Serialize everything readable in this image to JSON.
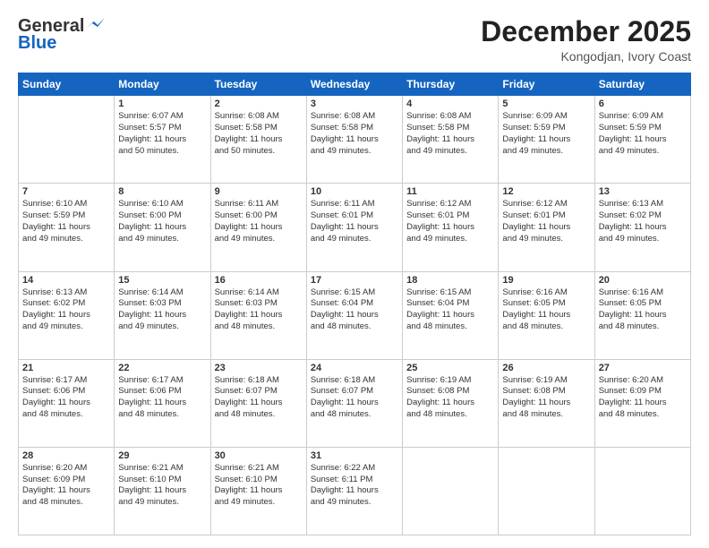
{
  "header": {
    "logo_line1": "General",
    "logo_line2": "Blue",
    "month": "December 2025",
    "location": "Kongodjan, Ivory Coast"
  },
  "weekdays": [
    "Sunday",
    "Monday",
    "Tuesday",
    "Wednesday",
    "Thursday",
    "Friday",
    "Saturday"
  ],
  "weeks": [
    [
      {
        "day": "",
        "info": ""
      },
      {
        "day": "1",
        "info": "Sunrise: 6:07 AM\nSunset: 5:57 PM\nDaylight: 11 hours\nand 50 minutes."
      },
      {
        "day": "2",
        "info": "Sunrise: 6:08 AM\nSunset: 5:58 PM\nDaylight: 11 hours\nand 50 minutes."
      },
      {
        "day": "3",
        "info": "Sunrise: 6:08 AM\nSunset: 5:58 PM\nDaylight: 11 hours\nand 49 minutes."
      },
      {
        "day": "4",
        "info": "Sunrise: 6:08 AM\nSunset: 5:58 PM\nDaylight: 11 hours\nand 49 minutes."
      },
      {
        "day": "5",
        "info": "Sunrise: 6:09 AM\nSunset: 5:59 PM\nDaylight: 11 hours\nand 49 minutes."
      },
      {
        "day": "6",
        "info": "Sunrise: 6:09 AM\nSunset: 5:59 PM\nDaylight: 11 hours\nand 49 minutes."
      }
    ],
    [
      {
        "day": "7",
        "info": "Sunrise: 6:10 AM\nSunset: 5:59 PM\nDaylight: 11 hours\nand 49 minutes."
      },
      {
        "day": "8",
        "info": "Sunrise: 6:10 AM\nSunset: 6:00 PM\nDaylight: 11 hours\nand 49 minutes."
      },
      {
        "day": "9",
        "info": "Sunrise: 6:11 AM\nSunset: 6:00 PM\nDaylight: 11 hours\nand 49 minutes."
      },
      {
        "day": "10",
        "info": "Sunrise: 6:11 AM\nSunset: 6:01 PM\nDaylight: 11 hours\nand 49 minutes."
      },
      {
        "day": "11",
        "info": "Sunrise: 6:12 AM\nSunset: 6:01 PM\nDaylight: 11 hours\nand 49 minutes."
      },
      {
        "day": "12",
        "info": "Sunrise: 6:12 AM\nSunset: 6:01 PM\nDaylight: 11 hours\nand 49 minutes."
      },
      {
        "day": "13",
        "info": "Sunrise: 6:13 AM\nSunset: 6:02 PM\nDaylight: 11 hours\nand 49 minutes."
      }
    ],
    [
      {
        "day": "14",
        "info": "Sunrise: 6:13 AM\nSunset: 6:02 PM\nDaylight: 11 hours\nand 49 minutes."
      },
      {
        "day": "15",
        "info": "Sunrise: 6:14 AM\nSunset: 6:03 PM\nDaylight: 11 hours\nand 49 minutes."
      },
      {
        "day": "16",
        "info": "Sunrise: 6:14 AM\nSunset: 6:03 PM\nDaylight: 11 hours\nand 48 minutes."
      },
      {
        "day": "17",
        "info": "Sunrise: 6:15 AM\nSunset: 6:04 PM\nDaylight: 11 hours\nand 48 minutes."
      },
      {
        "day": "18",
        "info": "Sunrise: 6:15 AM\nSunset: 6:04 PM\nDaylight: 11 hours\nand 48 minutes."
      },
      {
        "day": "19",
        "info": "Sunrise: 6:16 AM\nSunset: 6:05 PM\nDaylight: 11 hours\nand 48 minutes."
      },
      {
        "day": "20",
        "info": "Sunrise: 6:16 AM\nSunset: 6:05 PM\nDaylight: 11 hours\nand 48 minutes."
      }
    ],
    [
      {
        "day": "21",
        "info": "Sunrise: 6:17 AM\nSunset: 6:06 PM\nDaylight: 11 hours\nand 48 minutes."
      },
      {
        "day": "22",
        "info": "Sunrise: 6:17 AM\nSunset: 6:06 PM\nDaylight: 11 hours\nand 48 minutes."
      },
      {
        "day": "23",
        "info": "Sunrise: 6:18 AM\nSunset: 6:07 PM\nDaylight: 11 hours\nand 48 minutes."
      },
      {
        "day": "24",
        "info": "Sunrise: 6:18 AM\nSunset: 6:07 PM\nDaylight: 11 hours\nand 48 minutes."
      },
      {
        "day": "25",
        "info": "Sunrise: 6:19 AM\nSunset: 6:08 PM\nDaylight: 11 hours\nand 48 minutes."
      },
      {
        "day": "26",
        "info": "Sunrise: 6:19 AM\nSunset: 6:08 PM\nDaylight: 11 hours\nand 48 minutes."
      },
      {
        "day": "27",
        "info": "Sunrise: 6:20 AM\nSunset: 6:09 PM\nDaylight: 11 hours\nand 48 minutes."
      }
    ],
    [
      {
        "day": "28",
        "info": "Sunrise: 6:20 AM\nSunset: 6:09 PM\nDaylight: 11 hours\nand 48 minutes."
      },
      {
        "day": "29",
        "info": "Sunrise: 6:21 AM\nSunset: 6:10 PM\nDaylight: 11 hours\nand 49 minutes."
      },
      {
        "day": "30",
        "info": "Sunrise: 6:21 AM\nSunset: 6:10 PM\nDaylight: 11 hours\nand 49 minutes."
      },
      {
        "day": "31",
        "info": "Sunrise: 6:22 AM\nSunset: 6:11 PM\nDaylight: 11 hours\nand 49 minutes."
      },
      {
        "day": "",
        "info": ""
      },
      {
        "day": "",
        "info": ""
      },
      {
        "day": "",
        "info": ""
      }
    ]
  ]
}
